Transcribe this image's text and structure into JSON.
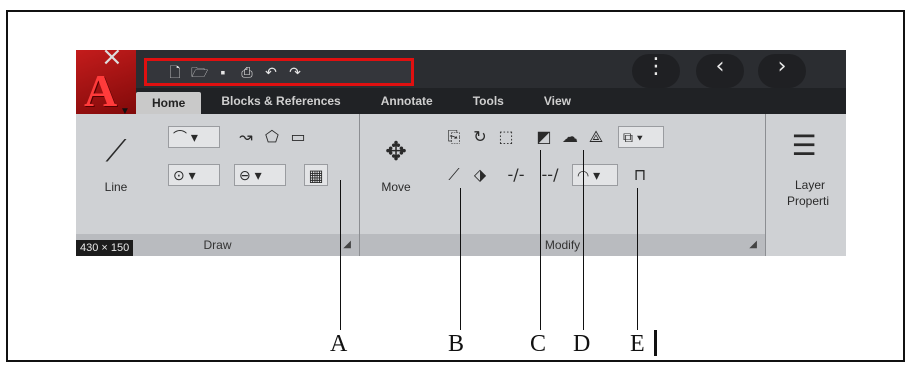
{
  "ribbon": {
    "tabs": [
      "Home",
      "Blocks & References",
      "Annotate",
      "Tools",
      "View"
    ],
    "panels": {
      "draw": {
        "title": "Draw",
        "big_tool_label": "Line"
      },
      "modify": {
        "title": "Modify",
        "big_tool_label": "Move"
      },
      "layers": {
        "big_tool_label_1": "Layer",
        "big_tool_label_2": "Properti"
      }
    },
    "size_badge": "430 × 150"
  },
  "callouts": [
    "A",
    "B",
    "C",
    "D",
    "E"
  ],
  "colors": {
    "highlight_border": "#e01010",
    "ribbon_dark": "#2b2d31",
    "ribbon_light": "#cfd1d4"
  }
}
